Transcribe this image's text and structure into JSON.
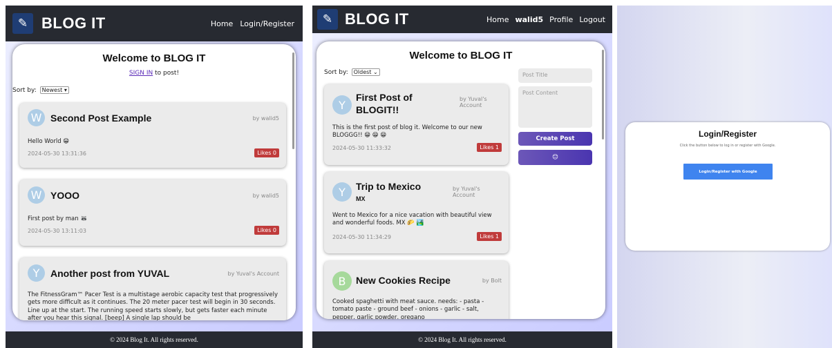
{
  "brand": "BLOG IT",
  "footer": "© 2024 Blog It. All rights reserved.",
  "panel1": {
    "nav": {
      "home": "Home",
      "login": "Login/Register"
    },
    "welcome": "Welcome to BLOG IT",
    "signin_link": "SIGN IN",
    "signin_rest": " to post!",
    "sort_label": "Sort by:",
    "sort_value": "Newest ▾",
    "posts": [
      {
        "initial": "W",
        "title": "Second Post Example",
        "author": "by walid5",
        "body": "Hello World 😁",
        "date": "2024-05-30 13:31:36",
        "likes": "Likes 0"
      },
      {
        "initial": "W",
        "title": "YOOO",
        "author": "by walid5",
        "body": "First post by man 🦝",
        "date": "2024-05-30 13:11:03",
        "likes": "Likes 0"
      },
      {
        "initial": "Y",
        "title": "Another post from YUVAL",
        "author": "by Yuval's Account",
        "body": "The FitnessGram™ Pacer Test is a multistage aerobic capacity test that progressively gets more difficult as it continues. The 20 meter pacer test will begin in 30 seconds. Line up at the start. The running speed starts slowly, but gets faster each minute after you hear this signal. [beep] A single lap should be"
      }
    ]
  },
  "panel2": {
    "nav": {
      "home": "Home",
      "user": "walid5",
      "profile": "Profile",
      "logout": "Logout"
    },
    "welcome": "Welcome to BLOG IT",
    "sort_label": "Sort by:",
    "sort_value": "Oldest ⌄",
    "form": {
      "title_placeholder": "Post Title",
      "content_placeholder": "Post Content",
      "create": "Create Post",
      "emoji": "😊"
    },
    "posts": [
      {
        "initial": "Y",
        "title": "First Post of BLOGIT!!",
        "author": "by Yuval's Account",
        "body": "This is the first post of blog it. Welcome to our new BLOGGG!! 😁 😁 😁",
        "date": "2024-05-30 11:33:32",
        "likes": "Likes 1"
      },
      {
        "initial": "Y",
        "title": "Trip to Mexico",
        "title_sub": "MX",
        "author": "by Yuval's Account",
        "body": "Went to Mexico for a nice vacation with beautiful view and wonderful foods. MX 🌮 🏞️",
        "date": "2024-05-30 11:34:29",
        "likes": "Likes 1"
      },
      {
        "initial": "B",
        "title": "New Cookies Recipe",
        "author": "by Bolt",
        "body": "Cooked spaghetti with meat sauce. needs: - pasta - tomato paste - ground beef - onions - garlic - salt, pepper, garlic powder, oregano"
      }
    ]
  },
  "panel3": {
    "title": "Login/Register",
    "desc": "Click the button below to log in or register with Google.",
    "button": "Login/Register with Google"
  }
}
